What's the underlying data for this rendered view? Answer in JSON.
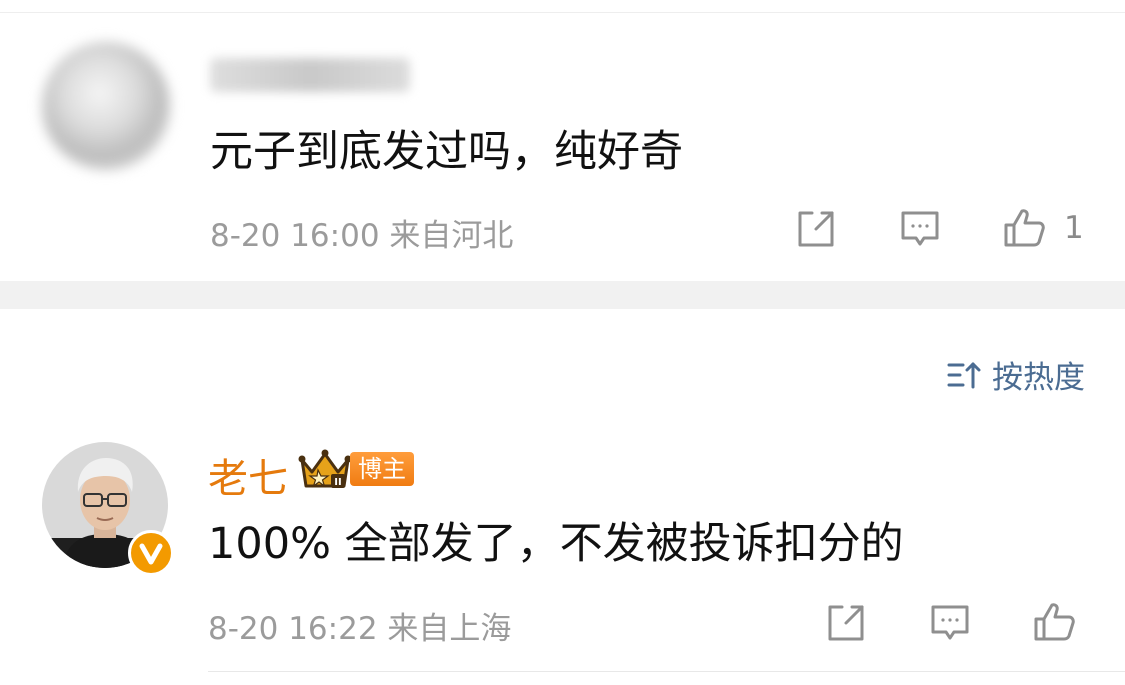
{
  "comments": [
    {
      "author": "",
      "text": "元子到底发过吗，纯好奇",
      "time": "8-20 16:00",
      "location": "来自河北",
      "like_count": "1"
    },
    {
      "author": "老七",
      "badge": "博主",
      "crown_level": "II",
      "text": "100% 全部发了，不发被投诉扣分的",
      "time": "8-20 16:22",
      "location": "来自上海",
      "like_count": ""
    }
  ],
  "sort": {
    "label": "按热度"
  },
  "icons": {
    "share": "share-icon",
    "comment": "comment-icon",
    "like": "like-icon",
    "sort": "sort-icon",
    "crown": "crown-icon",
    "verified": "verified-v-icon"
  },
  "colors": {
    "accent_orange": "#e57a0d",
    "sort_blue": "#4b6c92",
    "meta_gray": "#9b9b9b",
    "separator": "#f1f1f1"
  }
}
